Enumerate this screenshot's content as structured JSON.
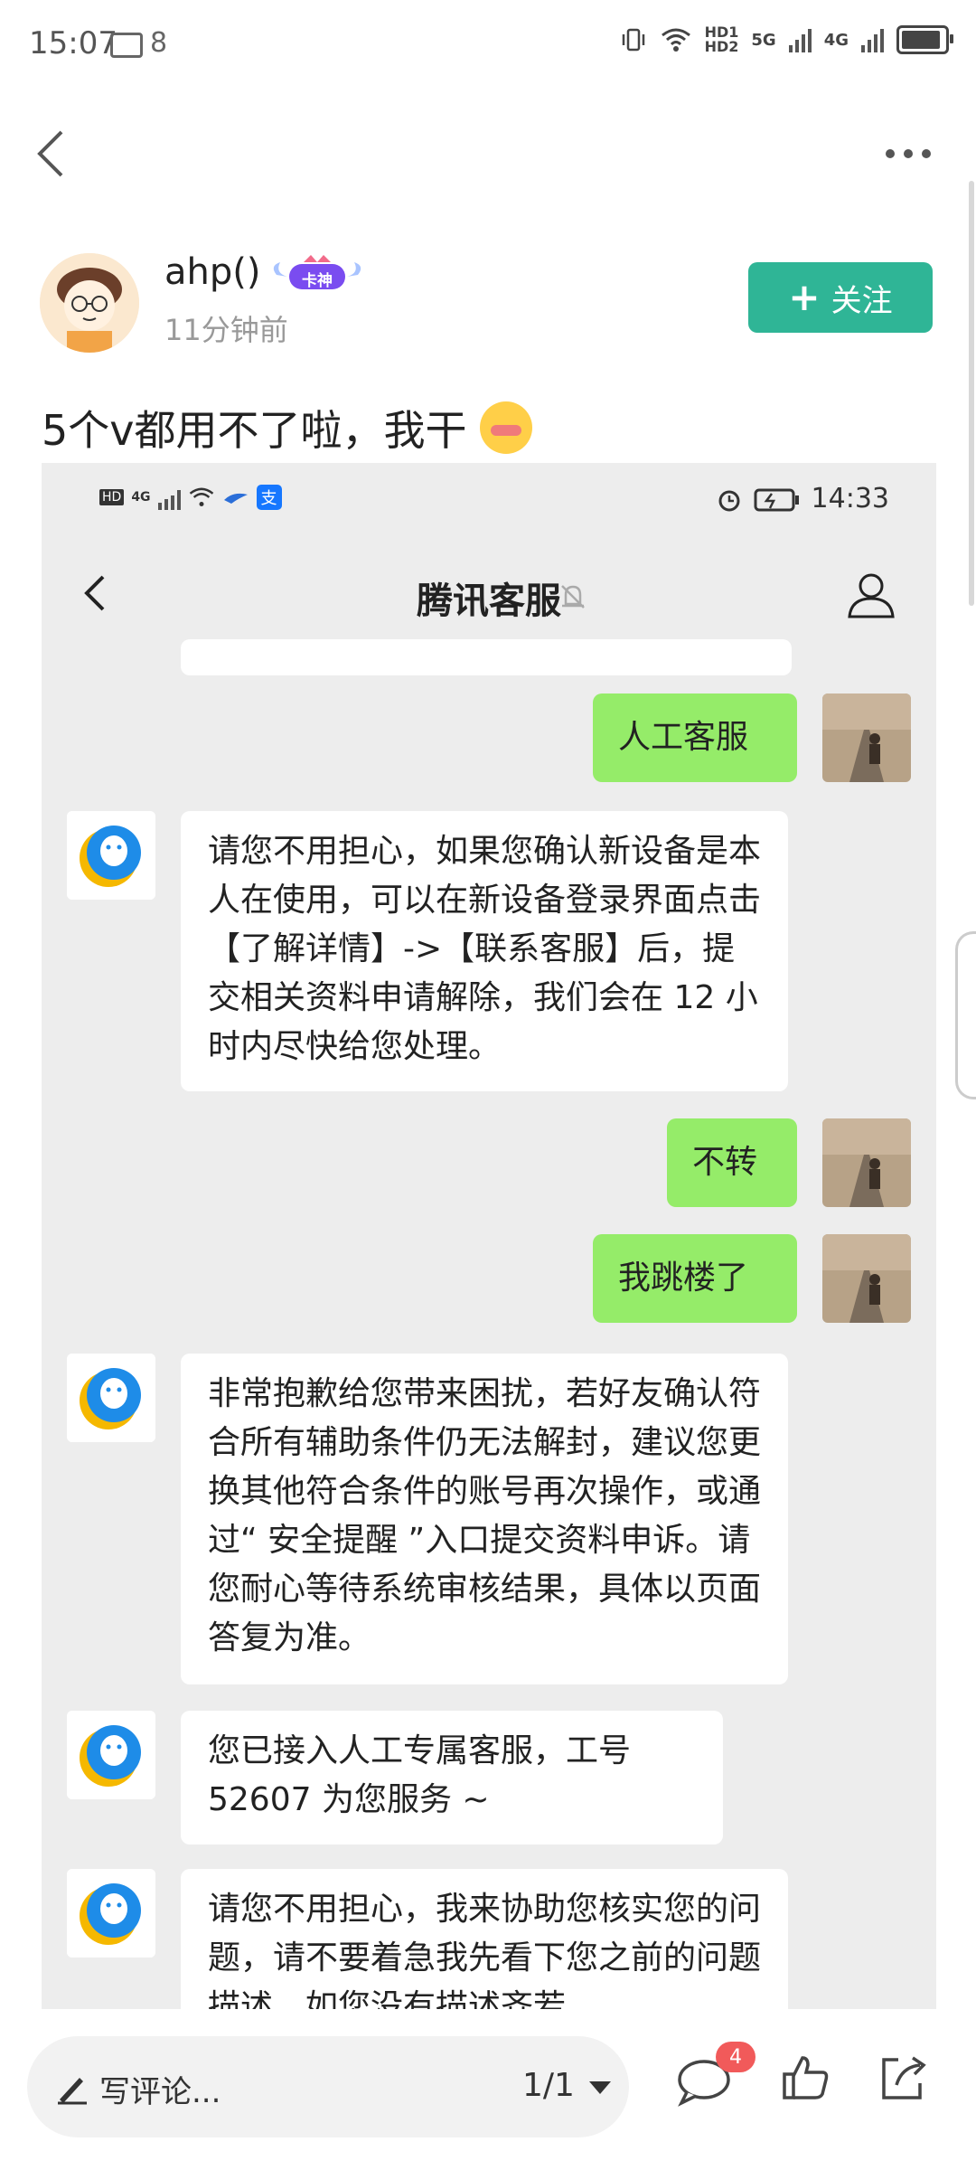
{
  "status_bar": {
    "time": "15:07",
    "message_count": "8",
    "hd_label": "HD1\nHD2",
    "network_5g": "5G",
    "network_4g": "4G"
  },
  "post": {
    "username": "ahp()",
    "badge_text": "卡神",
    "time_ago": "11分钟前",
    "follow_label": "关注",
    "follow_plus": "+",
    "text": "5个v都用不了啦，我干"
  },
  "screenshot": {
    "status": {
      "time": "14:33",
      "hd": "HD",
      "net": "4G",
      "alipay": "支"
    },
    "title": "腾讯客服",
    "messages": [
      {
        "side": "right",
        "text": "人工客服"
      },
      {
        "side": "left",
        "text": "请您不用担心，如果您确认新设备是本人在使用，可以在新设备登录界面点击【了解详情】->【联系客服】后，提交相关资料申请解除，我们会在 12 小时内尽快给您处理。"
      },
      {
        "side": "right",
        "text": "不转"
      },
      {
        "side": "right",
        "text": "我跳楼了"
      },
      {
        "side": "left",
        "text": "非常抱歉给您带来困扰，若好友确认符合所有辅助条件仍无法解封，建议您更换其他符合条件的账号再次操作，或通过“ 安全提醒 ”入口提交资料申诉。请您耐心等待系统审核结果，具体以页面答复为准。"
      },
      {
        "side": "left",
        "text": "您已接入人工专属客服，工号 52607 为您服务 ~"
      },
      {
        "side": "left",
        "text": "请您不用担心，我来协助您核实您的问题，请不要着急我先看下您之前的问题描述，如您没有描述齐若"
      }
    ]
  },
  "bottom_bar": {
    "comment_placeholder": "写评论...",
    "page_indicator": "1/1",
    "comment_count": "4"
  },
  "colors": {
    "follow_button": "#2fb596",
    "my_bubble": "#95ec69",
    "chat_bg": "#ededed",
    "badge_red": "#f15a5a"
  }
}
